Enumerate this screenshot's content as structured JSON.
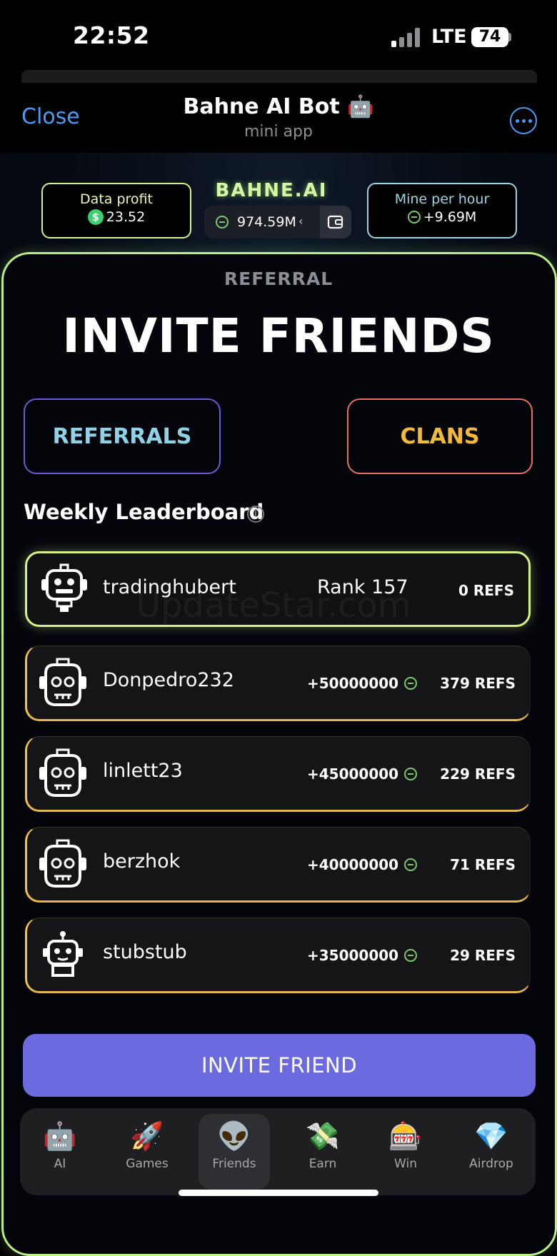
{
  "status_bar": {
    "time": "22:52",
    "network": "LTE",
    "battery": "74"
  },
  "header": {
    "close_label": "Close",
    "title": "Bahne AI Bot 🤖",
    "subtitle": "mini app"
  },
  "stats": {
    "data_profit_label": "Data profit",
    "data_profit_value": "23.52",
    "brand": "BAHNE.AI",
    "balance": "974.59M",
    "balance_arrow": "‹",
    "mine_label": "Mine per hour",
    "mine_value": "+9.69M"
  },
  "page": {
    "section": "REFERRAL",
    "title": "INVITE FRIENDS"
  },
  "tabs": {
    "referrals": "REFERRALS",
    "clans": "CLANS"
  },
  "leaderboard": {
    "title": "Weekly Leaderboard",
    "info_icon": "i",
    "me": {
      "username": "tradinghubert",
      "rank": "Rank 157",
      "refs": "0 REFS"
    },
    "rows": [
      {
        "username": "Donpedro232",
        "points": "+50000000",
        "refs": "379 REFS"
      },
      {
        "username": "linlett23",
        "points": "+45000000",
        "refs": "229 REFS"
      },
      {
        "username": "berzhok",
        "points": "+40000000",
        "refs": "71 REFS"
      },
      {
        "username": "stubstub",
        "points": "+35000000",
        "refs": "29 REFS"
      }
    ]
  },
  "watermark": "UpdateStar.com",
  "invite_label": "INVITE FRIEND",
  "nav": [
    {
      "icon": "🤖",
      "label": "AI"
    },
    {
      "icon": "🚀",
      "label": "Games"
    },
    {
      "icon": "👽",
      "label": "Friends"
    },
    {
      "icon": "💸",
      "label": "Earn"
    },
    {
      "icon": "🎰",
      "label": "Win"
    },
    {
      "icon": "💎",
      "label": "Airdrop"
    }
  ],
  "colors": {
    "accent_green": "#d4f287",
    "invite_purple": "#6c6adf",
    "link_blue": "#4a9cf5"
  }
}
